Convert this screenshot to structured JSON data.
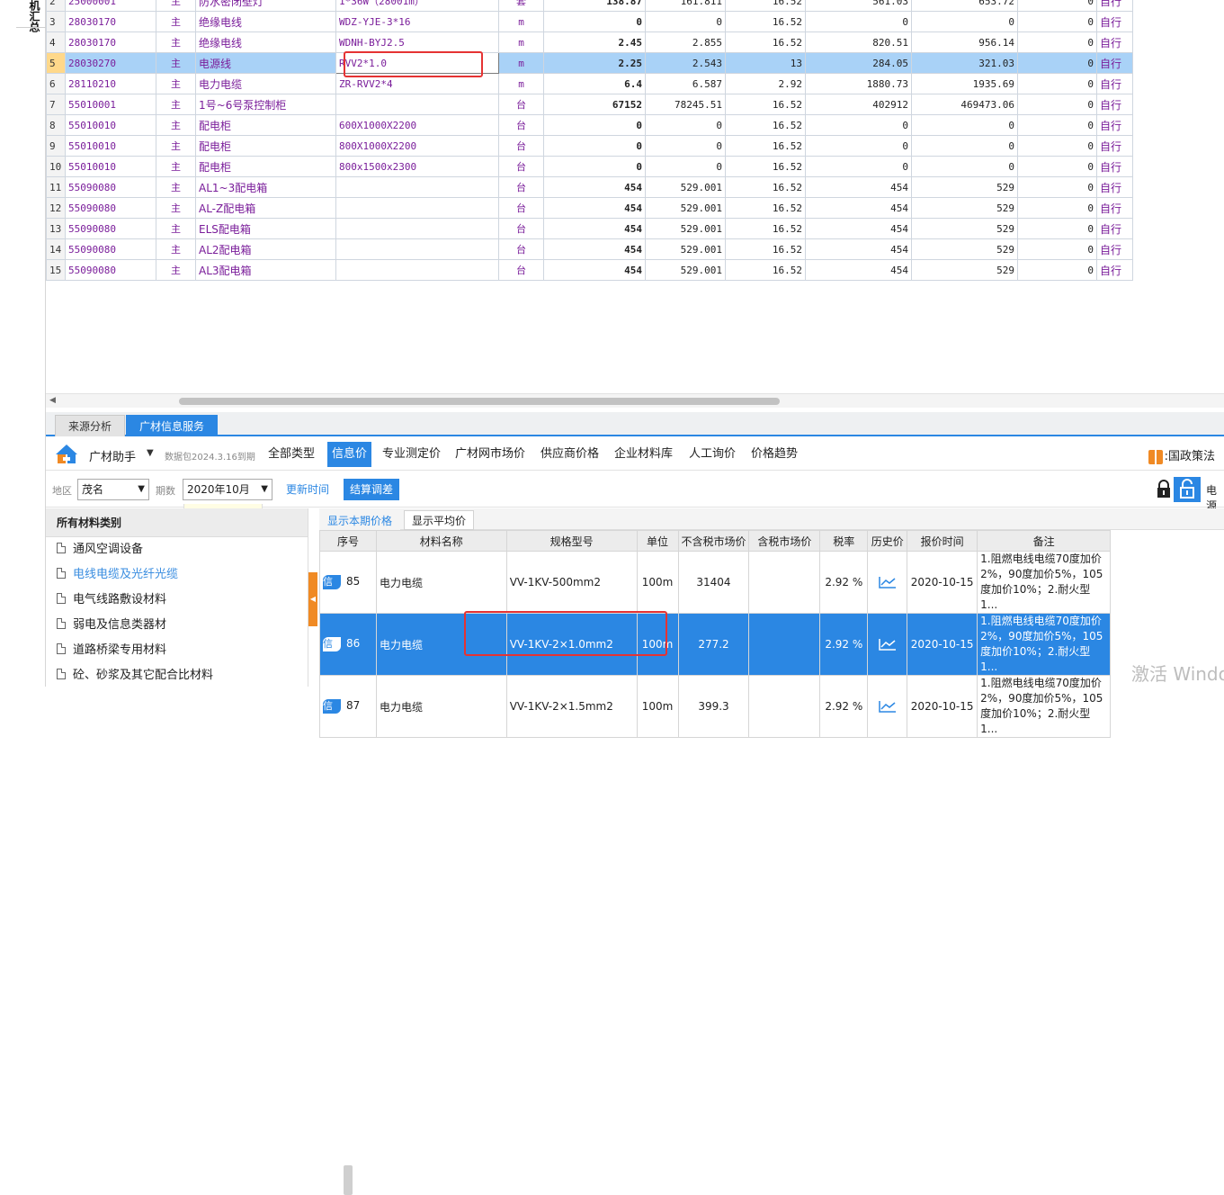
{
  "left_strip": {
    "label": "机汇总"
  },
  "grid": {
    "rows": [
      {
        "idx": "2",
        "code": "25000001",
        "type": "主",
        "name": "防水密闭壁灯",
        "spec": "1*36W（28001m）",
        "unit": "套",
        "qty": "138.87",
        "price": "161.811",
        "rate": "16.52",
        "amt1": "561.03",
        "amt2": "653.72",
        "v": "0",
        "src": "自行"
      },
      {
        "idx": "3",
        "code": "28030170",
        "type": "主",
        "name": "绝缘电线",
        "spec": "WDZ-YJE-3*16",
        "unit": "m",
        "qty": "0",
        "price": "0",
        "rate": "16.52",
        "amt1": "0",
        "amt2": "0",
        "v": "0",
        "src": "自行"
      },
      {
        "idx": "4",
        "code": "28030170",
        "type": "主",
        "name": "绝缘电线",
        "spec": "WDNH-BYJ2.5",
        "unit": "m",
        "qty": "2.45",
        "price": "2.855",
        "rate": "16.52",
        "amt1": "820.51",
        "amt2": "956.14",
        "v": "0",
        "src": "自行"
      },
      {
        "idx": "5",
        "code": "28030270",
        "type": "主",
        "name": "电源线",
        "spec": "RVV2*1.0",
        "unit": "m",
        "qty": "2.25",
        "price": "2.543",
        "rate": "13",
        "amt1": "284.05",
        "amt2": "321.03",
        "v": "0",
        "src": "自行"
      },
      {
        "idx": "6",
        "code": "28110210",
        "type": "主",
        "name": "电力电缆",
        "spec": "ZR-RVV2*4",
        "unit": "m",
        "qty": "6.4",
        "price": "6.587",
        "rate": "2.92",
        "amt1": "1880.73",
        "amt2": "1935.69",
        "v": "0",
        "src": "自行"
      },
      {
        "idx": "7",
        "code": "55010001",
        "type": "主",
        "name": "1号~6号泵控制柜",
        "spec": "",
        "unit": "台",
        "qty": "67152",
        "price": "78245.51",
        "rate": "16.52",
        "amt1": "402912",
        "amt2": "469473.06",
        "v": "0",
        "src": "自行"
      },
      {
        "idx": "8",
        "code": "55010010",
        "type": "主",
        "name": "配电柜",
        "spec": "600X1000X2200",
        "unit": "台",
        "qty": "0",
        "price": "0",
        "rate": "16.52",
        "amt1": "0",
        "amt2": "0",
        "v": "0",
        "src": "自行"
      },
      {
        "idx": "9",
        "code": "55010010",
        "type": "主",
        "name": "配电柜",
        "spec": "800X1000X2200",
        "unit": "台",
        "qty": "0",
        "price": "0",
        "rate": "16.52",
        "amt1": "0",
        "amt2": "0",
        "v": "0",
        "src": "自行"
      },
      {
        "idx": "10",
        "code": "55010010",
        "type": "主",
        "name": "配电柜",
        "spec": "800x1500x2300",
        "unit": "台",
        "qty": "0",
        "price": "0",
        "rate": "16.52",
        "amt1": "0",
        "amt2": "0",
        "v": "0",
        "src": "自行"
      },
      {
        "idx": "11",
        "code": "55090080",
        "type": "主",
        "name": "AL1~3配电箱",
        "spec": "",
        "unit": "台",
        "qty": "454",
        "price": "529.001",
        "rate": "16.52",
        "amt1": "454",
        "amt2": "529",
        "v": "0",
        "src": "自行"
      },
      {
        "idx": "12",
        "code": "55090080",
        "type": "主",
        "name": "AL-Z配电箱",
        "spec": "",
        "unit": "台",
        "qty": "454",
        "price": "529.001",
        "rate": "16.52",
        "amt1": "454",
        "amt2": "529",
        "v": "0",
        "src": "自行"
      },
      {
        "idx": "13",
        "code": "55090080",
        "type": "主",
        "name": "ELS配电箱",
        "spec": "",
        "unit": "台",
        "qty": "454",
        "price": "529.001",
        "rate": "16.52",
        "amt1": "454",
        "amt2": "529",
        "v": "0",
        "src": "自行"
      },
      {
        "idx": "14",
        "code": "55090080",
        "type": "主",
        "name": "AL2配电箱",
        "spec": "",
        "unit": "台",
        "qty": "454",
        "price": "529.001",
        "rate": "16.52",
        "amt1": "454",
        "amt2": "529",
        "v": "0",
        "src": "自行"
      },
      {
        "idx": "15",
        "code": "55090080",
        "type": "主",
        "name": "AL3配电箱",
        "spec": "",
        "unit": "台",
        "qty": "454",
        "price": "529.001",
        "rate": "16.52",
        "amt1": "454",
        "amt2": "529",
        "v": "0",
        "src": "自行"
      }
    ],
    "selected_index": 3
  },
  "bottom_tabs": [
    {
      "label": "来源分析"
    },
    {
      "label": "广材信息服务"
    }
  ],
  "toolbar": {
    "brand": "广材助手",
    "package_note": "数据包2024.3.16到期",
    "nav": [
      "全部类型",
      "信息价",
      "专业测定价",
      "广材网市场价",
      "供应商价格",
      "企业材料库",
      "人工询价",
      "价格趋势"
    ],
    "active_nav": 1,
    "policy": ":国政策法"
  },
  "filters": {
    "region_label": "地区",
    "region_value": "茂名",
    "period_label": "期数",
    "period_value": "2020年10月",
    "update_button": "更新时间",
    "settle_button": "结算调差",
    "elec_button": "电源"
  },
  "categories": {
    "title": "所有材料类别",
    "items": [
      "通风空调设备",
      "电线电缆及光纤光缆",
      "电气线路敷设材料",
      "弱电及信息类器材",
      "道路桥梁专用材料",
      "砼、砂浆及其它配合比材料"
    ],
    "active": 1
  },
  "sub_tabs": [
    "显示本期价格",
    "显示平均价"
  ],
  "price_table": {
    "headers": [
      "序号",
      "材料名称",
      "规格型号",
      "单位",
      "不含税市场价",
      "含税市场价",
      "税率",
      "历史价",
      "报价时间",
      "备注"
    ],
    "badge": "信",
    "rows": [
      {
        "no": "85",
        "name": "电力电缆",
        "spec": "VV-1KV-500mm2",
        "unit": "100m",
        "price": "31404",
        "tax_price": "",
        "rate": "2.92 %",
        "date": "2020-10-15",
        "note": "1.阻燃电线电缆70度加价2%，90度加价5%，105度加价10%；2.耐火型1..."
      },
      {
        "no": "86",
        "name": "电力电缆",
        "spec": "VV-1KV-2×1.0mm2",
        "unit": "100m",
        "price": "277.2",
        "tax_price": "",
        "rate": "2.92 %",
        "date": "2020-10-15",
        "note": "1.阻燃电线电缆70度加价2%，90度加价5%，105度加价10%；2.耐火型1..."
      },
      {
        "no": "87",
        "name": "电力电缆",
        "spec": "VV-1KV-2×1.5mm2",
        "unit": "100m",
        "price": "399.3",
        "tax_price": "",
        "rate": "2.92 %",
        "date": "2020-10-15",
        "note": "1.阻燃电线电缆70度加价2%，90度加价5%，105度加价10%；2.耐火型1..."
      }
    ],
    "selected_index": 1
  },
  "watermark": "激活 Windows",
  "colors": {
    "accent": "#2b87e3",
    "highlight_row": "#a9d2f7",
    "annotation": "#e53333",
    "orange": "#f08a24"
  }
}
